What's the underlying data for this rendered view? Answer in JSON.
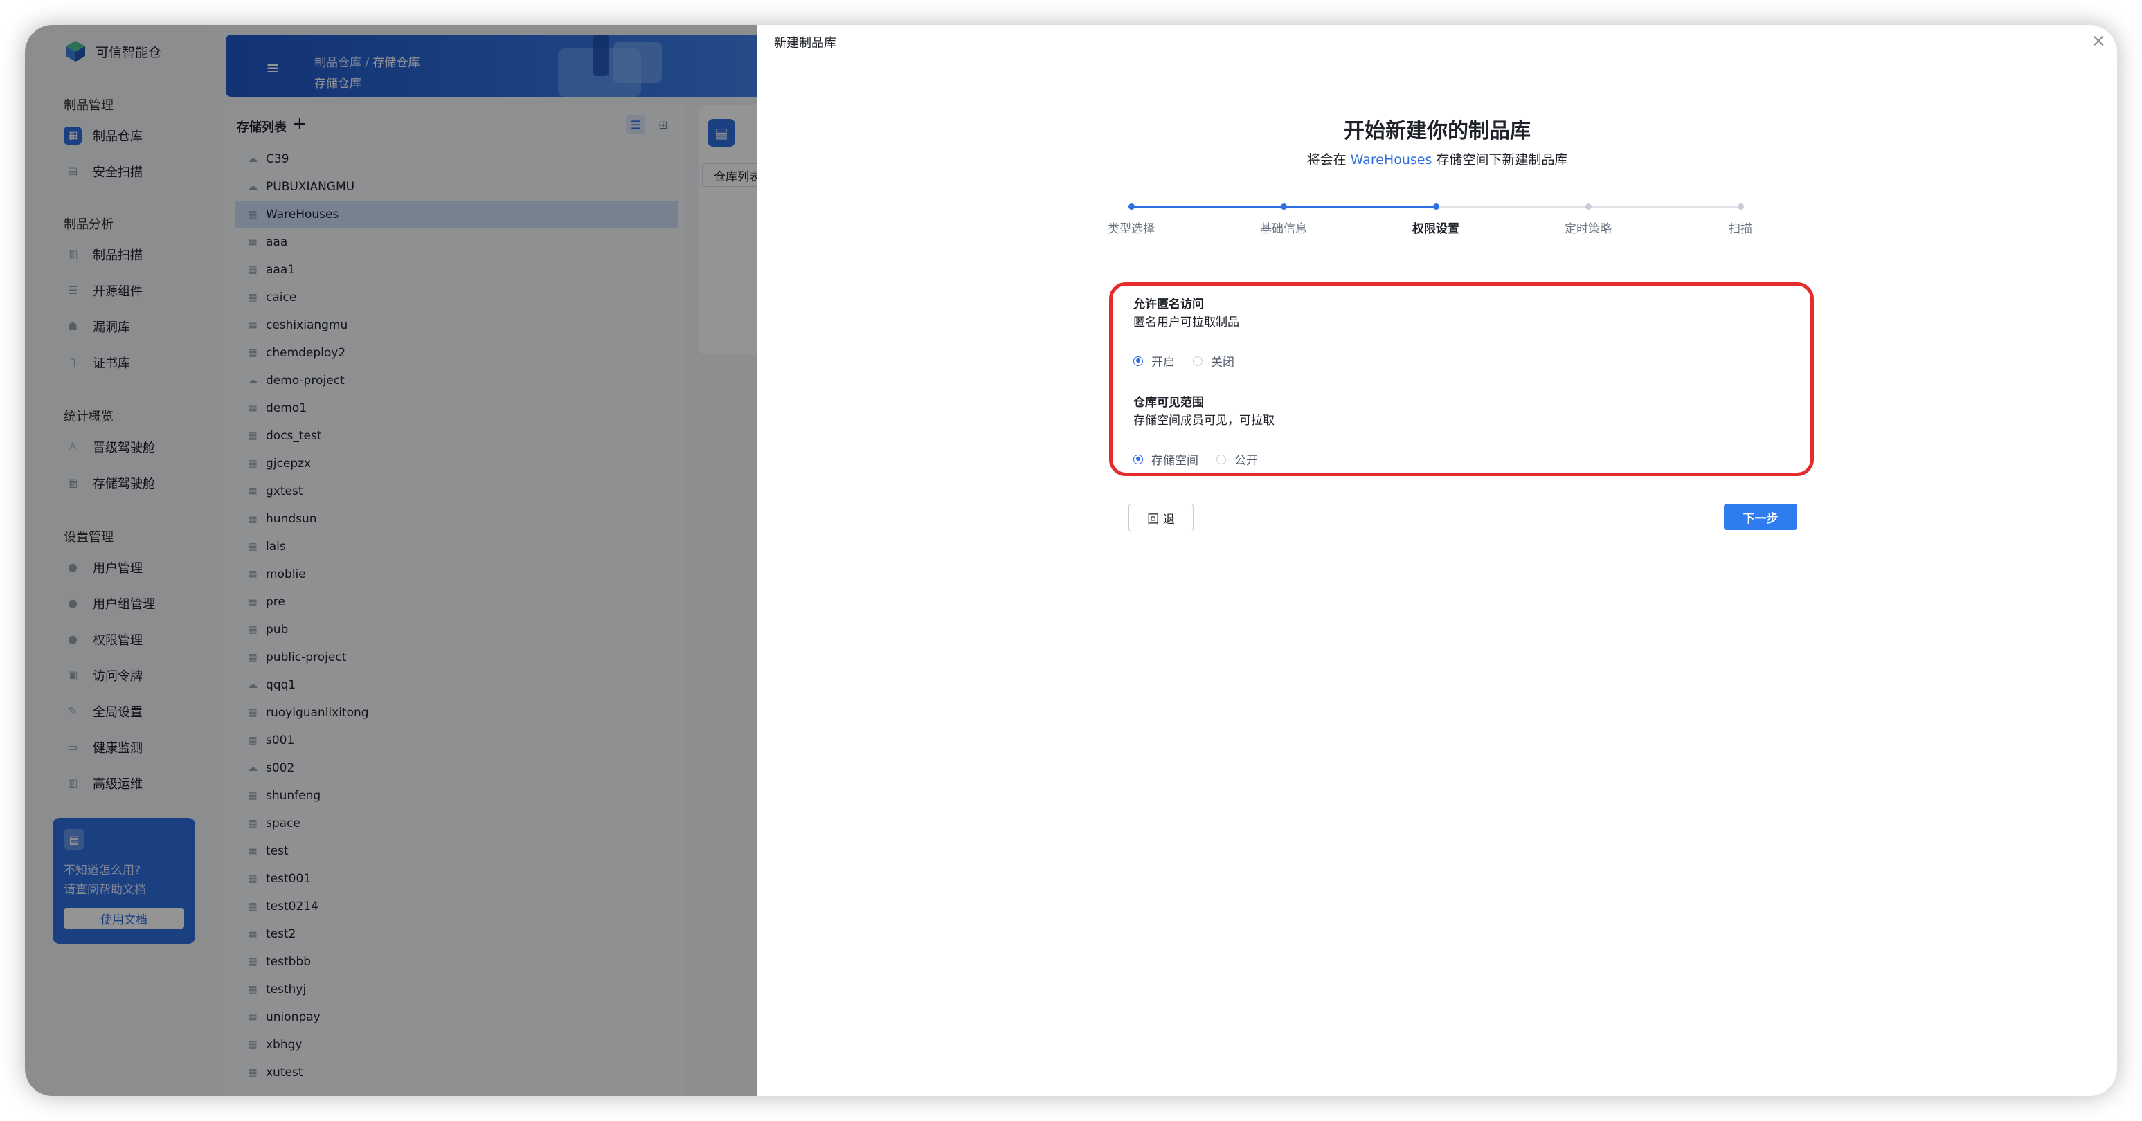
{
  "app": {
    "name": "可信智能仓"
  },
  "sidebar": {
    "groups": [
      {
        "title": "制品管理",
        "items": [
          {
            "label": "制品仓库",
            "icon": "warehouse-icon",
            "active": true
          },
          {
            "label": "安全扫描",
            "icon": "scan-icon"
          }
        ]
      },
      {
        "title": "制品分析",
        "items": [
          {
            "label": "制品扫描",
            "icon": "artifact-scan-icon"
          },
          {
            "label": "开源组件",
            "icon": "component-icon"
          },
          {
            "label": "漏洞库",
            "icon": "vulnerability-icon"
          },
          {
            "label": "证书库",
            "icon": "certificate-icon"
          }
        ]
      },
      {
        "title": "统计概览",
        "items": [
          {
            "label": "晋级驾驶舱",
            "icon": "promotion-dashboard-icon"
          },
          {
            "label": "存储驾驶舱",
            "icon": "storage-dashboard-icon"
          }
        ]
      },
      {
        "title": "设置管理",
        "items": [
          {
            "label": "用户管理",
            "icon": "user-icon"
          },
          {
            "label": "用户组管理",
            "icon": "user-group-icon"
          },
          {
            "label": "权限管理",
            "icon": "permission-icon"
          },
          {
            "label": "访问令牌",
            "icon": "token-icon"
          },
          {
            "label": "全局设置",
            "icon": "wrench-icon"
          },
          {
            "label": "健康监测",
            "icon": "monitor-icon"
          },
          {
            "label": "高级运维",
            "icon": "ops-icon"
          }
        ]
      }
    ],
    "help": {
      "line1": "不知道怎么用?",
      "line2": "请查阅帮助文档",
      "button": "使用文档"
    }
  },
  "header": {
    "breadcrumb_parent": "制品仓库",
    "breadcrumb_sep": "/",
    "breadcrumb_current": "存储仓库",
    "title": "存储仓库"
  },
  "storage_list": {
    "title": "存储列表",
    "items": [
      {
        "name": "C39",
        "type": "cloud"
      },
      {
        "name": "PUBUXIANGMU",
        "type": "cloud"
      },
      {
        "name": "WareHouses",
        "type": "grid",
        "selected": true
      },
      {
        "name": "aaa",
        "type": "grid"
      },
      {
        "name": "aaa1",
        "type": "grid"
      },
      {
        "name": "caice",
        "type": "grid"
      },
      {
        "name": "ceshixiangmu",
        "type": "grid"
      },
      {
        "name": "chemdeploy2",
        "type": "grid"
      },
      {
        "name": "demo-project",
        "type": "cloud"
      },
      {
        "name": "demo1",
        "type": "grid"
      },
      {
        "name": "docs_test",
        "type": "grid"
      },
      {
        "name": "gjcepzx",
        "type": "grid"
      },
      {
        "name": "gxtest",
        "type": "grid"
      },
      {
        "name": "hundsun",
        "type": "grid"
      },
      {
        "name": "lais",
        "type": "grid"
      },
      {
        "name": "moblie",
        "type": "grid"
      },
      {
        "name": "pre",
        "type": "grid"
      },
      {
        "name": "pub",
        "type": "grid"
      },
      {
        "name": "public-project",
        "type": "grid"
      },
      {
        "name": "qqq1",
        "type": "cloud"
      },
      {
        "name": "ruoyiguanlixitong",
        "type": "grid"
      },
      {
        "name": "s001",
        "type": "grid"
      },
      {
        "name": "s002",
        "type": "cloud"
      },
      {
        "name": "shunfeng",
        "type": "grid"
      },
      {
        "name": "space",
        "type": "grid"
      },
      {
        "name": "test",
        "type": "grid"
      },
      {
        "name": "test001",
        "type": "grid"
      },
      {
        "name": "test0214",
        "type": "grid"
      },
      {
        "name": "test2",
        "type": "grid"
      },
      {
        "name": "testbbb",
        "type": "grid"
      },
      {
        "name": "testhyj",
        "type": "grid"
      },
      {
        "name": "unionpay",
        "type": "grid"
      },
      {
        "name": "xbhgy",
        "type": "grid"
      },
      {
        "name": "xutest",
        "type": "grid"
      }
    ]
  },
  "detail": {
    "tab": "仓库列表"
  },
  "drawer": {
    "title": "新建制品库",
    "heading": "开始新建你的制品库",
    "sub_prefix": "将会在",
    "sub_link": "WareHouses",
    "sub_suffix": "存储空间下新建制品库",
    "steps": [
      {
        "label": "类型选择",
        "state": "done"
      },
      {
        "label": "基础信息",
        "state": "done"
      },
      {
        "label": "权限设置",
        "state": "current"
      },
      {
        "label": "定时策略",
        "state": "todo"
      },
      {
        "label": "扫描",
        "state": "todo"
      }
    ],
    "anonymous": {
      "title": "允许匿名访问",
      "desc": "匿名用户可拉取制品",
      "options": [
        "开启",
        "关闭"
      ],
      "selected": "开启"
    },
    "visibility": {
      "title": "仓库可见范围",
      "desc": "存储空间成员可见，可拉取",
      "options": [
        "存储空间",
        "公开"
      ],
      "selected": "存储空间"
    },
    "back_button": "回 退",
    "next_button": "下一步"
  },
  "colors": {
    "accent": "#2f6ee0",
    "highlight_box": "#e42c2c",
    "next_button": "#2f7bf0"
  }
}
